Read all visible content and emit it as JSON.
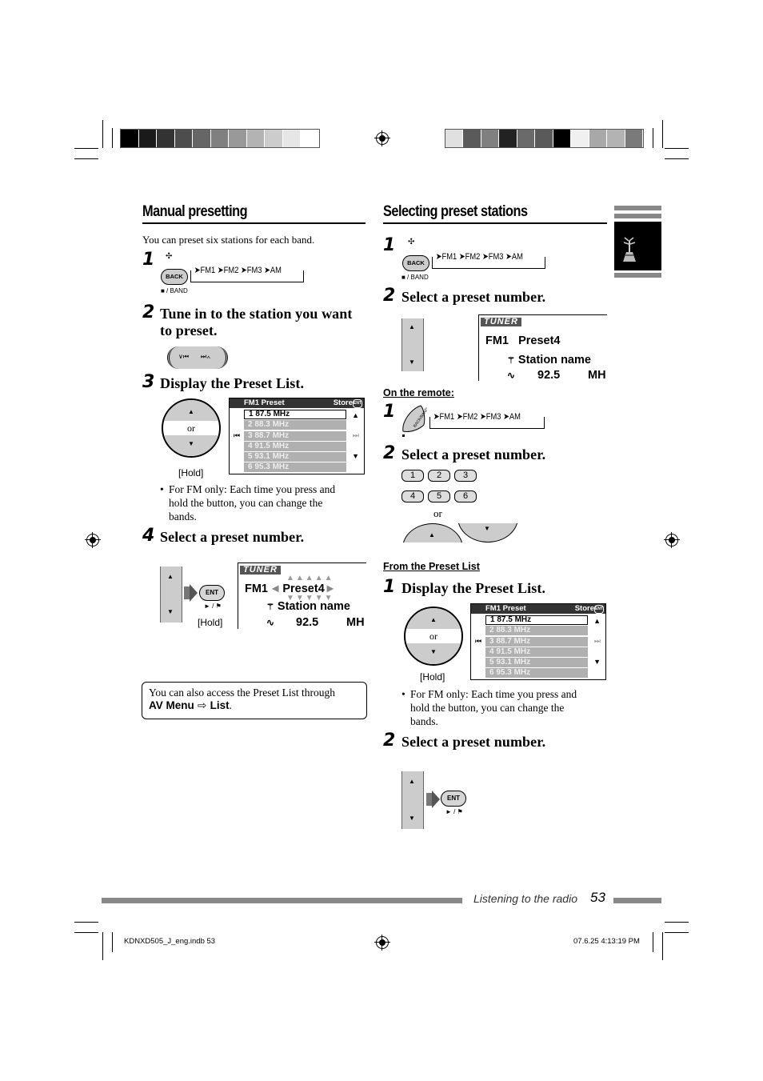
{
  "print_marks": {
    "left_swatches": [
      "#000000",
      "#1a1a1a",
      "#333333",
      "#4d4d4d",
      "#666666",
      "#808080",
      "#999999",
      "#b3b3b3",
      "#cccccc",
      "#e6e6e6",
      "#ffffff"
    ],
    "right_swatches": [
      "#e0e0e0",
      "#5a5a5a",
      "#808080",
      "#222222",
      "#6a6a6a",
      "#5a5a5a",
      "#000000",
      "#f0f0f0",
      "#a8a8a8",
      "#b3b3b3",
      "#7a7a7a"
    ]
  },
  "left": {
    "title": "Manual presetting",
    "intro": "You can preset six stations for each band.",
    "step1": {
      "num": "1",
      "back_label": "BACK",
      "under_label": "■ / BAND",
      "band_sequence": "➤FM1 ➤FM2 ➤FM3 ➤AM"
    },
    "step2": {
      "num": "2",
      "text_line1": "Tune in to the station you want",
      "text_line2": "to preset."
    },
    "step3": {
      "num": "3",
      "text": "Display the Preset List.",
      "or_label": "or",
      "hold_label": "[Hold]",
      "bullet_line1": "For FM only: Each time you press and",
      "bullet_line2": "hold the button, you can change the",
      "bullet_line3": "bands."
    },
    "step4": {
      "num": "4",
      "text": "Select a preset number.",
      "ent_label": "ENT",
      "ent_sub": "► / ⚑",
      "hold_label": "[Hold]"
    },
    "note": {
      "text": "You can also access the Preset List through",
      "bold1": "AV Menu",
      "arrow": "⇨",
      "bold2": "List",
      "end": "."
    }
  },
  "preset_list": {
    "header": "FM1 Preset",
    "store": "Store",
    "ent": "ENT",
    "rows": [
      "1  87.5 MHz",
      "2  88.3 MHz",
      "3  88.7 MHz",
      "4  91.5 MHz",
      "5  93.1 MHz",
      "6  95.3 MHz"
    ],
    "selected_index": 0,
    "prev_icon": "⏮",
    "next_icon": "⏭",
    "up_icon": "▲",
    "down_icon": "▼"
  },
  "tuner_display": {
    "tag": "TUNER",
    "band": "FM1",
    "preset": "Preset4",
    "station": "Station name",
    "freq": "92.5",
    "unit": "MH"
  },
  "right": {
    "title": "Selecting preset stations",
    "step1": {
      "num": "1",
      "back_label": "BACK",
      "under_label": "■ / BAND",
      "band_sequence": "➤FM1 ➤FM2 ➤FM3 ➤AM"
    },
    "step2": {
      "num": "2",
      "text": "Select a preset number."
    },
    "remote_heading": "On the remote:",
    "remote_step1": {
      "num": "1",
      "button_label": "BACK/BAND",
      "band_sequence": "➤FM1 ➤FM2 ➤FM3 ➤AM"
    },
    "remote_step2": {
      "num": "2",
      "text": "Select a preset number.",
      "keys": [
        "1",
        "2",
        "3",
        "4",
        "5",
        "6"
      ],
      "or_label": "or"
    },
    "preset_list_heading": "From the Preset List",
    "list_step1": {
      "num": "1",
      "text": "Display the Preset List.",
      "or_label": "or",
      "hold_label": "[Hold]",
      "bullet_line1": "For FM only: Each time you press and",
      "bullet_line2": "hold the button, you can change the",
      "bullet_line3": "bands."
    },
    "list_step2": {
      "num": "2",
      "text": "Select a preset number.",
      "ent_label": "ENT",
      "ent_sub": "► / ⚑"
    }
  },
  "footer": {
    "section": "Listening to the radio",
    "page": "53",
    "file": "KDNXD505_J_eng.indb   53",
    "timestamp": "07.6.25   4:13:19 PM"
  }
}
